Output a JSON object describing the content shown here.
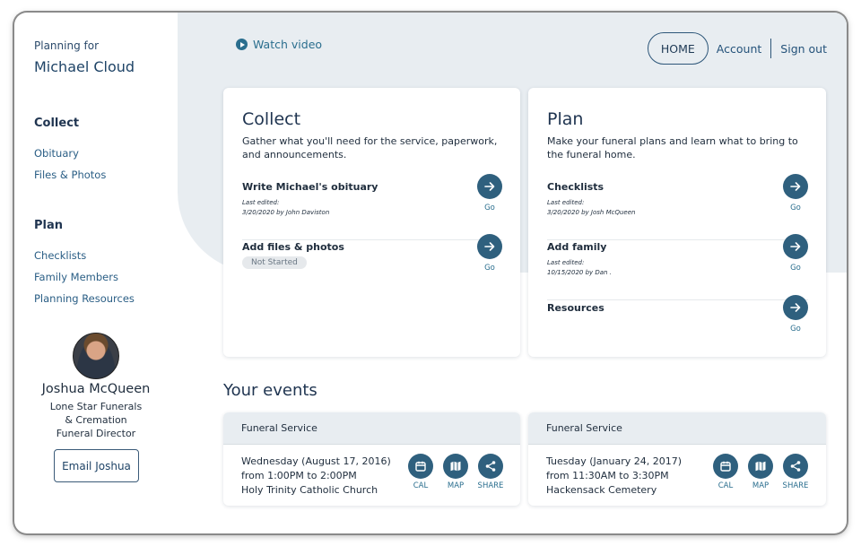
{
  "sidebar": {
    "planning_for_label": "Planning for",
    "planner_name": "Michael Cloud",
    "collect_heading": "Collect",
    "collect_items": [
      "Obituary",
      "Files & Photos"
    ],
    "plan_heading": "Plan",
    "plan_items": [
      "Checklists",
      "Family Members",
      "Planning Resources"
    ],
    "director": {
      "name": "Joshua McQueen",
      "company": "Lone Star Funerals & Cremation",
      "title": "Funeral Director",
      "email_button": "Email Joshua"
    }
  },
  "topbar": {
    "watch_video": "Watch video",
    "nav": {
      "home": "HOME",
      "account": "Account",
      "signout": "Sign out"
    }
  },
  "collect_card": {
    "title": "Collect",
    "description": "Gather what you'll need for the service, paperwork, and announcements.",
    "rows": [
      {
        "title": "Write Michael's obituary",
        "edited_label": "Last edited:",
        "edited_value": "3/20/2020 by John Daviston",
        "go": "Go"
      },
      {
        "title": "Add files & photos",
        "badge": "Not Started",
        "go": "Go"
      }
    ]
  },
  "plan_card": {
    "title": "Plan",
    "description": "Make your funeral plans and learn what to bring to the funeral home.",
    "rows": [
      {
        "title": "Checklists",
        "edited_label": "Last edited:",
        "edited_value": "3/20/2020 by Josh McQueen",
        "go": "Go"
      },
      {
        "title": "Add family",
        "edited_label": "Last edited:",
        "edited_value": "10/15/2020 by Dan .",
        "go": "Go"
      },
      {
        "title": "Resources",
        "go": "Go"
      }
    ]
  },
  "events": {
    "title": "Your events",
    "items": [
      {
        "type": "Funeral Service",
        "date": "Wednesday (August 17, 2016)",
        "time": "from 1:00PM to 2:00PM",
        "location": "Holy Trinity Catholic Church",
        "actions": [
          "CAL",
          "MAP",
          "SHARE"
        ]
      },
      {
        "type": "Funeral Service",
        "date": "Tuesday (January 24, 2017)",
        "time": "from 11:30AM to 3:30PM",
        "location": "Hackensack Cemetery",
        "actions": [
          "CAL",
          "MAP",
          "SHARE"
        ]
      }
    ]
  },
  "colors": {
    "accent": "#2f607e",
    "link": "#2a6e8e",
    "panel_bg": "#e8edf1"
  }
}
